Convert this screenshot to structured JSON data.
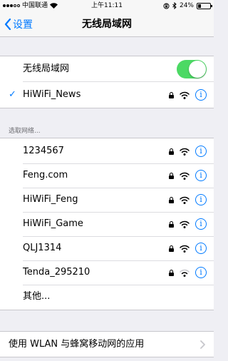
{
  "status_bar": {
    "carrier": "中国联通",
    "time": "上午11:11",
    "battery_percent": "24%"
  },
  "navbar": {
    "back_label": "设置",
    "title": "无线局域网"
  },
  "wifi_toggle": {
    "label": "无线局域网",
    "on": true,
    "color": "#4cd964"
  },
  "connected_network": {
    "name": "HiWiFi_News",
    "secured": true
  },
  "section_header": "选取网络...",
  "networks": [
    {
      "name": "1234567",
      "secured": true
    },
    {
      "name": "Feng.com",
      "secured": true
    },
    {
      "name": "HiWiFi_Feng",
      "secured": true
    },
    {
      "name": "HiWiFi_Game",
      "secured": true
    },
    {
      "name": "QLJ1314",
      "secured": true
    },
    {
      "name": "Tenda_295210",
      "secured": true
    }
  ],
  "other_label": "其他...",
  "apps_row": {
    "label": "使用 WLAN 与蜂窝移动网的应用"
  },
  "accent_color": "#007aff"
}
